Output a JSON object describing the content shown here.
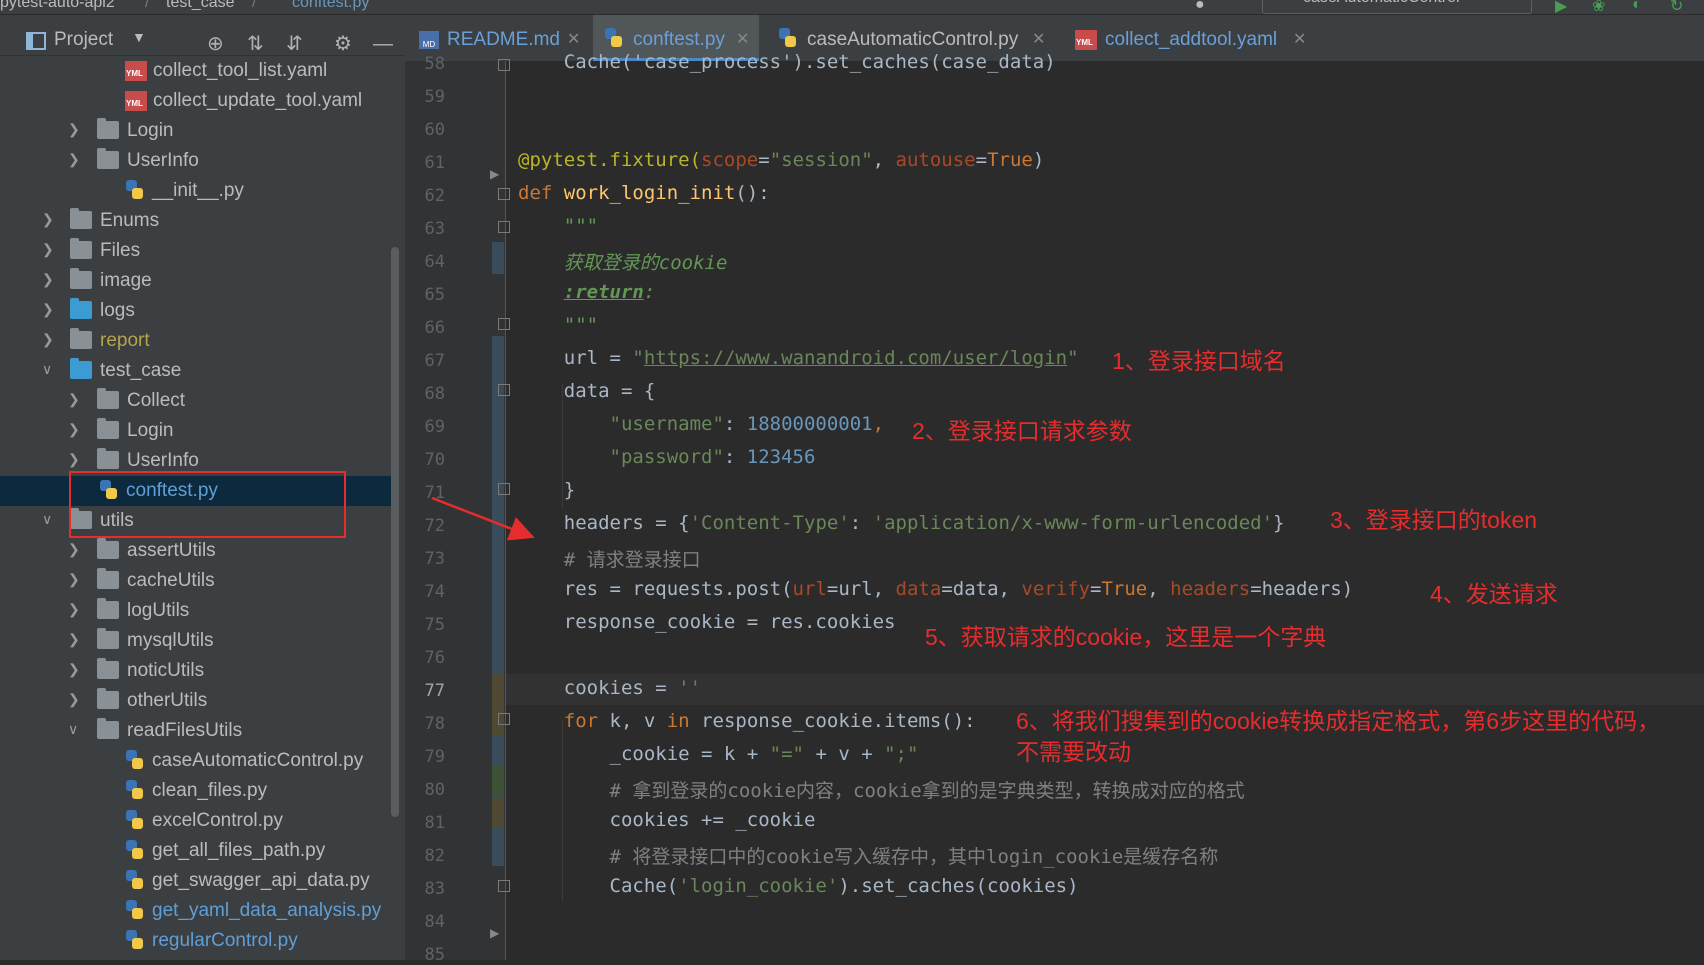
{
  "breadcrumb": {
    "project": "pytest-auto-api2",
    "folder": "test_case",
    "file": "conftest.py"
  },
  "run_config": "caseAutomaticControl",
  "project_panel": {
    "title": "Project",
    "tree": [
      {
        "label": "collect_tool_list.yaml",
        "type": "yaml",
        "depth": 3
      },
      {
        "label": "collect_update_tool.yaml",
        "type": "yaml",
        "depth": 3
      },
      {
        "label": "Login",
        "type": "folder",
        "depth": 2,
        "collapsed": true
      },
      {
        "label": "UserInfo",
        "type": "folder",
        "depth": 2,
        "collapsed": true
      },
      {
        "label": "__init__.py",
        "type": "py",
        "depth": 3
      },
      {
        "label": "Enums",
        "type": "folder",
        "depth": 1,
        "collapsed": true
      },
      {
        "label": "Files",
        "type": "folder",
        "depth": 1,
        "collapsed": true
      },
      {
        "label": "image",
        "type": "folder",
        "depth": 1,
        "collapsed": true
      },
      {
        "label": "logs",
        "type": "folder-blue",
        "depth": 1,
        "collapsed": true
      },
      {
        "label": "report",
        "type": "folder",
        "depth": 1,
        "collapsed": true,
        "color": "yellow"
      },
      {
        "label": "test_case",
        "type": "folder-blue",
        "depth": 1,
        "collapsed": false
      },
      {
        "label": "Collect",
        "type": "folder",
        "depth": 2,
        "collapsed": true
      },
      {
        "label": "Login",
        "type": "folder",
        "depth": 2,
        "collapsed": true
      },
      {
        "label": "UserInfo",
        "type": "folder",
        "depth": 2,
        "collapsed": true
      },
      {
        "label": "conftest.py",
        "type": "py",
        "depth": 2,
        "selected": true,
        "color": "blue"
      },
      {
        "label": "utils",
        "type": "folder",
        "depth": 1,
        "collapsed": false
      },
      {
        "label": "assertUtils",
        "type": "folder",
        "depth": 2,
        "collapsed": true
      },
      {
        "label": "cacheUtils",
        "type": "folder",
        "depth": 2,
        "collapsed": true
      },
      {
        "label": "logUtils",
        "type": "folder",
        "depth": 2,
        "collapsed": true
      },
      {
        "label": "mysqlUtils",
        "type": "folder",
        "depth": 2,
        "collapsed": true
      },
      {
        "label": "noticUtils",
        "type": "folder",
        "depth": 2,
        "collapsed": true
      },
      {
        "label": "otherUtils",
        "type": "folder",
        "depth": 2,
        "collapsed": true
      },
      {
        "label": "readFilesUtils",
        "type": "folder",
        "depth": 2,
        "collapsed": false
      },
      {
        "label": "caseAutomaticControl.py",
        "type": "py",
        "depth": 3
      },
      {
        "label": "clean_files.py",
        "type": "py",
        "depth": 3
      },
      {
        "label": "excelControl.py",
        "type": "py",
        "depth": 3
      },
      {
        "label": "get_all_files_path.py",
        "type": "py",
        "depth": 3
      },
      {
        "label": "get_swagger_api_data.py",
        "type": "py",
        "depth": 3
      },
      {
        "label": "get_yaml_data_analysis.py",
        "type": "py",
        "depth": 3,
        "color": "blue"
      },
      {
        "label": "regularControl.py",
        "type": "py",
        "depth": 3,
        "color": "blue"
      }
    ]
  },
  "tabs": [
    {
      "label": "README.md",
      "icon": "markdown-icon",
      "active": false
    },
    {
      "label": "conftest.py",
      "icon": "python-icon",
      "active": true
    },
    {
      "label": "caseAutomaticControl.py",
      "icon": "python-icon",
      "active": false
    },
    {
      "label": "collect_addtool.yaml",
      "icon": "yaml-icon",
      "active": false
    }
  ],
  "editor": {
    "current_line": 77,
    "line_numbers": [
      "58",
      "59",
      "60",
      "61",
      "62",
      "63",
      "64",
      "65",
      "66",
      "67",
      "68",
      "69",
      "70",
      "71",
      "72",
      "73",
      "74",
      "75",
      "76",
      "77",
      "78",
      "79",
      "80",
      "81",
      "82",
      "83",
      "84",
      "85"
    ],
    "lines": {
      "l58": "    Cache('case_process').set_caches(case_data)",
      "l61_dec": "@pytest.fixture(",
      "l61_p1": "scope",
      "l61_s1": "\"session\"",
      "l61_p2": "autouse",
      "l61_v2": "True",
      "l62_kw": "def ",
      "l62_fn": "work_login_init",
      "l62_rest": "():",
      "l63": "\"\"\"",
      "l64": "获取登录的cookie",
      "l65_tag": ":return",
      "l65_rest": ":",
      "l66": "\"\"\"",
      "l67_a": "url = ",
      "l67_q1": "\"",
      "l67_url": "https://www.wanandroid.com/user/login",
      "l67_q2": "\"",
      "l68": "data = {",
      "l69_key": "\"username\"",
      "l69_val": "18800000001",
      "l70_key": "\"password\"",
      "l70_val": "123456",
      "l71": "}",
      "l72_a": "headers = {",
      "l72_k": "'Content-Type'",
      "l72_v": "'application/x-www-form-urlencoded'",
      "l72_b": "}",
      "l73": "# 请求登录接口",
      "l74_a": "res = requests.post(",
      "l74_p1": "url",
      "l74_v1": "url, ",
      "l74_p2": "data",
      "l74_v2": "data, ",
      "l74_p3": "verify",
      "l74_v3": "True",
      "l74_p4": "headers",
      "l74_v4": "headers)",
      "l75": "response_cookie = res.cookies",
      "l77_a": "cookies = ",
      "l77_s": "''",
      "l78_kw1": "for ",
      "l78_a": "k, v ",
      "l78_kw2": "in ",
      "l78_b": "response_cookie.items():",
      "l79_a": "_cookie = k + ",
      "l79_s1": "\"=\"",
      "l79_b": " + v + ",
      "l79_s2": "\";\"",
      "l80": "# 拿到登录的cookie内容，cookie拿到的是字典类型，转换成对应的格式",
      "l81": "cookies += _cookie",
      "l82": "# 将登录接口中的cookie写入缓存中，其中login_cookie是缓存名称",
      "l83_a": "Cache(",
      "l83_s": "'login_cookie'",
      "l83_b": ").set_caches(cookies)"
    }
  },
  "annotations": {
    "a1": "1、登录接口域名",
    "a2": "2、登录接口请求参数",
    "a3": "3、登录接口的token",
    "a4": "4、发送请求",
    "a5": "5、获取请求的cookie，这里是一个字典",
    "a6_line1": "6、将我们搜集到的cookie转换成指定格式，第6步这里的代码，",
    "a6_line2": "不需要改动"
  }
}
